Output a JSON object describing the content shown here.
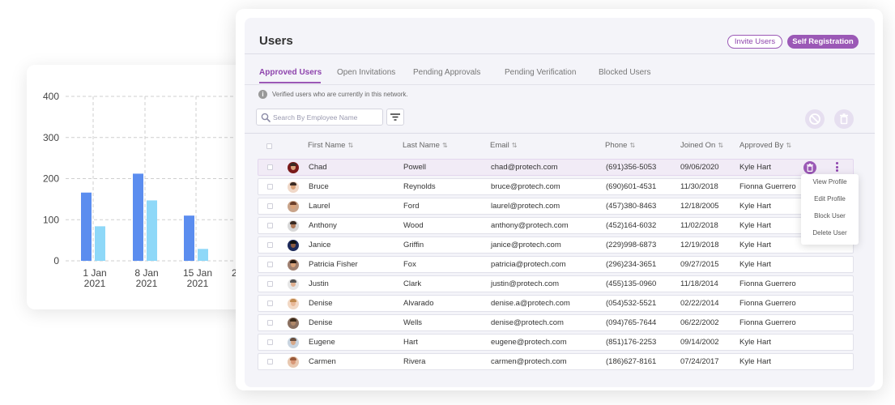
{
  "chart_data": {
    "type": "bar",
    "categories": [
      "1 Jan 2021",
      "8 Jan 2021",
      "15 Jan 2021"
    ],
    "category_lines": [
      [
        "1 Jan",
        "2021"
      ],
      [
        "8 Jan",
        "2021"
      ],
      [
        "15 Jan",
        "2021"
      ]
    ],
    "series": [
      {
        "values": [
          166,
          212,
          110
        ],
        "color": "#5b8def"
      },
      {
        "values": [
          84,
          147,
          29
        ],
        "color": "#8ed8f8"
      }
    ],
    "yticks": [
      0,
      100,
      200,
      300,
      400
    ],
    "ylim": [
      0,
      400
    ],
    "xlabel": "",
    "ylabel": "",
    "title": "",
    "grid": true,
    "clipped_label": "2"
  },
  "page": {
    "title": "Users",
    "invite_label": "Invite Users",
    "self_registration_label": "Self Registration",
    "info_text": "Verified users who are currently in this network.",
    "search_placeholder": "Search By Employee Name",
    "accent_color": "#9b59b6"
  },
  "tabs": [
    {
      "label": "Approved Users",
      "active": true
    },
    {
      "label": "Open Invitations",
      "active": false
    },
    {
      "label": "Pending Approvals",
      "active": false
    },
    {
      "label": "Pending Verification",
      "active": false
    },
    {
      "label": "Blocked Users",
      "active": false
    }
  ],
  "columns": [
    "First Name",
    "Last Name",
    "Email",
    "Phone",
    "Joined On",
    "Approved By"
  ],
  "sort_icon": "⇅",
  "rows": [
    {
      "first": "Chad",
      "last": "Powell",
      "email": "chad@protech.com",
      "phone": "(691)356-5053",
      "joined": "09/06/2020",
      "approved_by": "Kyle Hart",
      "selected": true
    },
    {
      "first": "Bruce",
      "last": "Reynolds",
      "email": "bruce@protech.com",
      "phone": "(690)601-4531",
      "joined": "11/30/2018",
      "approved_by": "Fionna Guerrero"
    },
    {
      "first": "Laurel",
      "last": "Ford",
      "email": "laurel@protech.com",
      "phone": "(457)380-8463",
      "joined": "12/18/2005",
      "approved_by": "Kyle Hart"
    },
    {
      "first": "Anthony",
      "last": "Wood",
      "email": "anthony@protech.com",
      "phone": "(452)164-6032",
      "joined": "11/02/2018",
      "approved_by": "Kyle Hart"
    },
    {
      "first": "Janice",
      "last": "Griffin",
      "email": "janice@protech.com",
      "phone": "(229)998-6873",
      "joined": "12/19/2018",
      "approved_by": "Kyle Hart"
    },
    {
      "first": "Patricia Fisher",
      "last": "Fox",
      "email": "patricia@protech.com",
      "phone": "(296)234-3651",
      "joined": "09/27/2015",
      "approved_by": "Kyle Hart"
    },
    {
      "first": "Justin",
      "last": "Clark",
      "email": "justin@protech.com",
      "phone": "(455)135-0960",
      "joined": "11/18/2014",
      "approved_by": "Fionna Guerrero"
    },
    {
      "first": "Denise",
      "last": "Alvarado",
      "email": "denise.a@protech.com",
      "phone": "(054)532-5521",
      "joined": "02/22/2014",
      "approved_by": "Fionna Guerrero"
    },
    {
      "first": "Denise",
      "last": "Wells",
      "email": "denise@protech.com",
      "phone": "(094)765-7644",
      "joined": "06/22/2002",
      "approved_by": "Fionna Guerrero"
    },
    {
      "first": "Eugene",
      "last": "Hart",
      "email": "eugene@protech.com",
      "phone": "(851)176-2253",
      "joined": "09/14/2002",
      "approved_by": "Kyle Hart"
    },
    {
      "first": "Carmen",
      "last": "Rivera",
      "email": "carmen@protech.com",
      "phone": "(186)627-8161",
      "joined": "07/24/2017",
      "approved_by": "Kyle Hart"
    }
  ],
  "row_menu": [
    "View Profile",
    "Edit Profile",
    "Block User",
    "Delete User"
  ]
}
